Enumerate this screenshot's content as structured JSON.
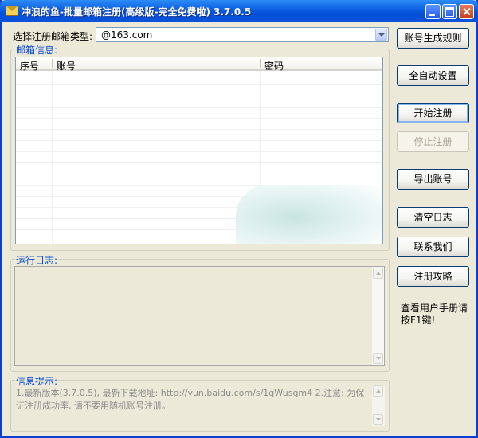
{
  "window": {
    "title": "冲浪的鱼-批量邮箱注册(高级版-完全免费啦) 3.7.0.5"
  },
  "email_type": {
    "label": "选择注册邮箱类型:",
    "value": "@163.com"
  },
  "mailbox_group": {
    "title": "邮箱信息:",
    "columns": [
      "序号",
      "账号",
      "密码"
    ],
    "rows": []
  },
  "log_group": {
    "title": "运行日志:",
    "content": ""
  },
  "info_group": {
    "title": "信息提示:",
    "text": "1.最新版本(3.7.0.5), 最新下载地址: http://yun.baidu.com/s/1qWusgm4 2.注意: 为保证注册成功率, 请不要用随机账号注册。"
  },
  "buttons": {
    "account_rule": "账号生成规则",
    "auto_settings": "全自动设置",
    "start": "开始注册",
    "stop": "停止注册",
    "export": "导出账号",
    "clear_log": "清空日志",
    "contact": "联系我们",
    "guide": "注册攻略"
  },
  "help_text": "查看用户手册请按F1键!",
  "colors": {
    "titlebar": "#0A52DA",
    "group_title": "#0046D5",
    "button_border": "#003C74"
  }
}
